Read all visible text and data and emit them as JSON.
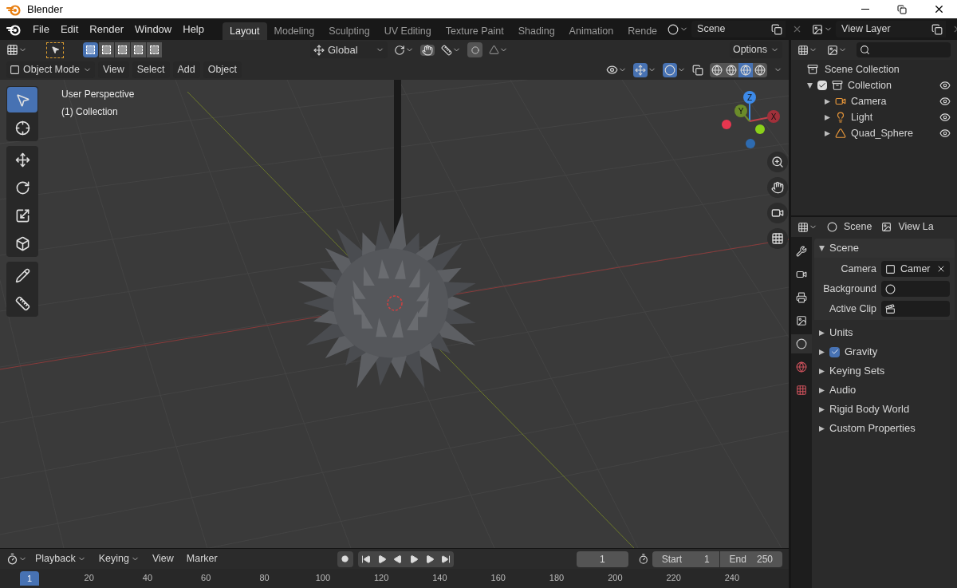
{
  "window": {
    "title": "Blender"
  },
  "menu": [
    "File",
    "Edit",
    "Render",
    "Window",
    "Help"
  ],
  "workspace_tabs": [
    {
      "label": "Layout",
      "selected": true
    },
    {
      "label": "Modeling",
      "selected": false
    },
    {
      "label": "Sculpting",
      "selected": false
    },
    {
      "label": "UV Editing",
      "selected": false
    },
    {
      "label": "Texture Paint",
      "selected": false
    },
    {
      "label": "Shading",
      "selected": false
    },
    {
      "label": "Animation",
      "selected": false
    },
    {
      "label": "Rende",
      "selected": false
    }
  ],
  "scene_selector": {
    "value": "Scene"
  },
  "view_layer_selector": {
    "value": "View Layer"
  },
  "tool_settings": {
    "orientation": "Global",
    "options": "Options"
  },
  "viewport_header": {
    "mode": "Object Mode",
    "menus": [
      "View",
      "Select",
      "Add",
      "Object"
    ]
  },
  "viewport": {
    "info": [
      "User Perspective",
      "(1) Collection"
    ],
    "gizmo_axes": [
      "Z",
      "Y",
      "X"
    ]
  },
  "toolbar": [
    {
      "kind": "select",
      "selected": true
    },
    {
      "kind": "cursor",
      "selected": false
    },
    {
      "kind": "move",
      "selected": false
    },
    {
      "kind": "rotate",
      "selected": false
    },
    {
      "kind": "scale",
      "selected": false
    },
    {
      "kind": "transform",
      "selected": false
    },
    {
      "kind": "annotate",
      "selected": false
    },
    {
      "kind": "measure",
      "selected": false
    }
  ],
  "outliner": {
    "root": "Scene Collection",
    "items": [
      {
        "label": "Collection",
        "checked": true,
        "expanded": true,
        "children": [
          {
            "label": "Camera",
            "kind": "camera",
            "expanded": false
          },
          {
            "label": "Light",
            "kind": "light",
            "expanded": false
          },
          {
            "label": "Quad_Sphere",
            "kind": "mesh",
            "expanded": false
          }
        ]
      }
    ]
  },
  "properties": {
    "header_tabs": [
      "Scene",
      "View La"
    ],
    "side_tabs": [
      {
        "kind": "tool",
        "selected": false
      },
      {
        "kind": "render",
        "selected": false
      },
      {
        "kind": "output",
        "selected": false
      },
      {
        "kind": "view_layer",
        "selected": false
      },
      {
        "kind": "scene",
        "selected": true
      },
      {
        "kind": "world",
        "selected": false
      },
      {
        "kind": "texture",
        "selected": false
      }
    ],
    "panel": {
      "title": "Scene",
      "expanded": true,
      "fields": [
        {
          "label": "Camera",
          "kind": "object",
          "value": "Camer"
        },
        {
          "label": "Background",
          "kind": "scene"
        },
        {
          "label": "Active Clip",
          "kind": "clip"
        }
      ]
    },
    "sections": [
      {
        "label": "Units",
        "kind": "plain",
        "expanded": false
      },
      {
        "label": "Gravity",
        "kind": "toggle",
        "checked": true,
        "expanded": false
      },
      {
        "label": "Keying Sets",
        "kind": "plain",
        "expanded": false
      },
      {
        "label": "Audio",
        "kind": "plain",
        "expanded": false
      },
      {
        "label": "Rigid Body World",
        "kind": "plain",
        "expanded": false
      },
      {
        "label": "Custom Properties",
        "kind": "plain",
        "expanded": false
      }
    ]
  },
  "timeline": {
    "menus": [
      "Playback",
      "Keying",
      "View",
      "Marker"
    ],
    "current_frame": "1",
    "start": {
      "label": "Start",
      "value": "1"
    },
    "end": {
      "label": "End",
      "value": "250"
    },
    "ruler_current": "1",
    "ruler_labels": [
      "20",
      "40",
      "60",
      "80",
      "100",
      "120",
      "140",
      "160",
      "180",
      "200",
      "220",
      "240"
    ]
  }
}
